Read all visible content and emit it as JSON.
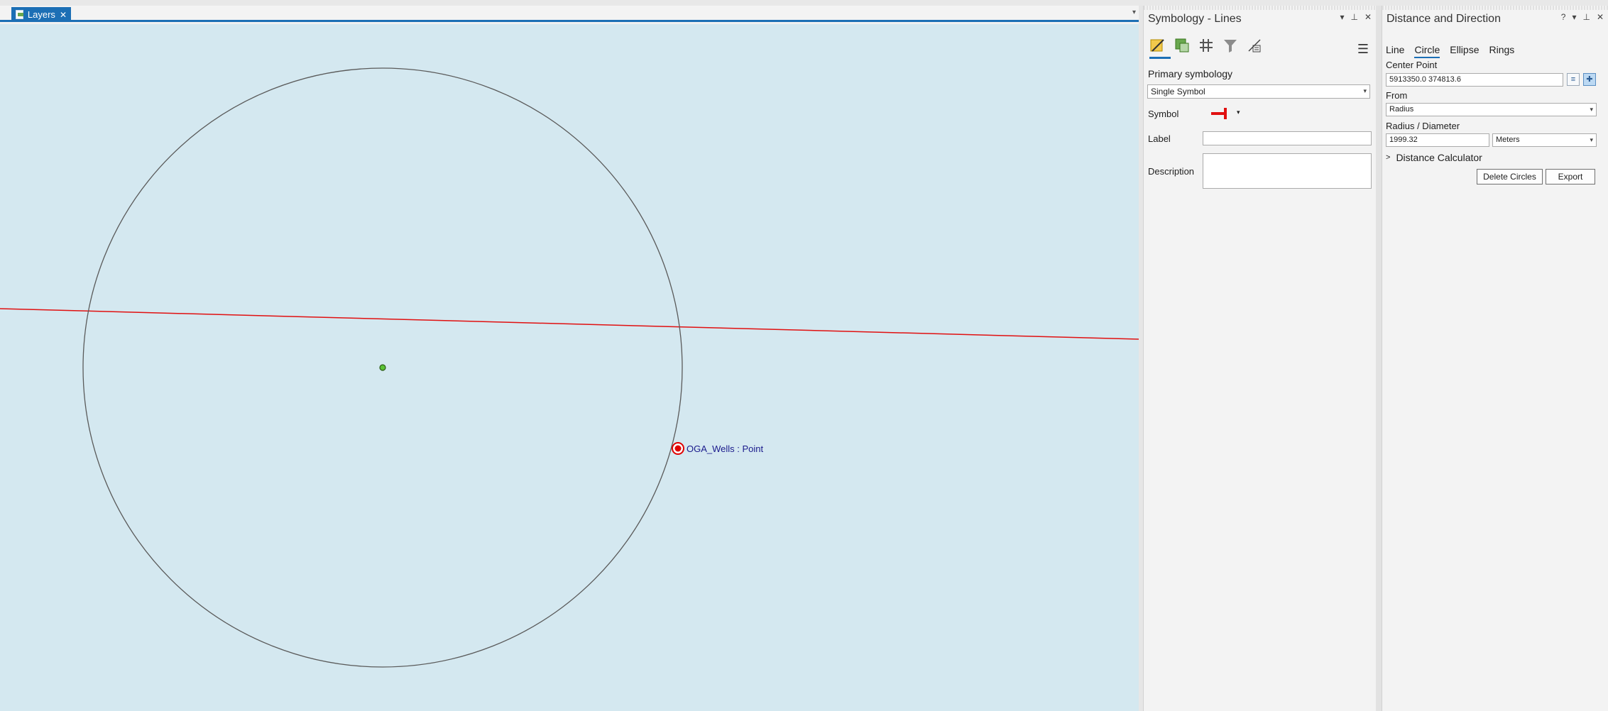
{
  "map": {
    "tab_label": "Layers",
    "point_label": "OGA_Wells : Point",
    "colors": {
      "background": "#d4e8f0",
      "line": "#e11010",
      "circle": "#5a5a5a",
      "center": "#2e8b1f",
      "point": "#e00000",
      "accent": "#1c6fb5"
    }
  },
  "symbology": {
    "title": "Symbology - Lines",
    "primary_label": "Primary symbology",
    "primary_value": "Single Symbol",
    "symbol_label": "Symbol",
    "label_label": "Label",
    "label_value": "",
    "description_label": "Description",
    "description_value": "",
    "toolbar_icons": [
      "primary-symbology-icon",
      "vary-symbology-icon",
      "symbol-layer-drawing-icon",
      "symbology-filter-icon",
      "masking-icon"
    ]
  },
  "distance": {
    "title": "Distance and Direction",
    "tabs": [
      "Line",
      "Circle",
      "Ellipse",
      "Rings"
    ],
    "active_tab": "Circle",
    "center_point_label": "Center Point",
    "center_point_value": "5913350.0 374813.6",
    "from_label": "From",
    "from_value": "Radius",
    "radius_label": "Radius / Diameter",
    "radius_value": "1999.32",
    "units_value": "Meters",
    "calculator_label": "Distance Calculator",
    "delete_button": "Delete Circles",
    "export_button": "Export"
  }
}
